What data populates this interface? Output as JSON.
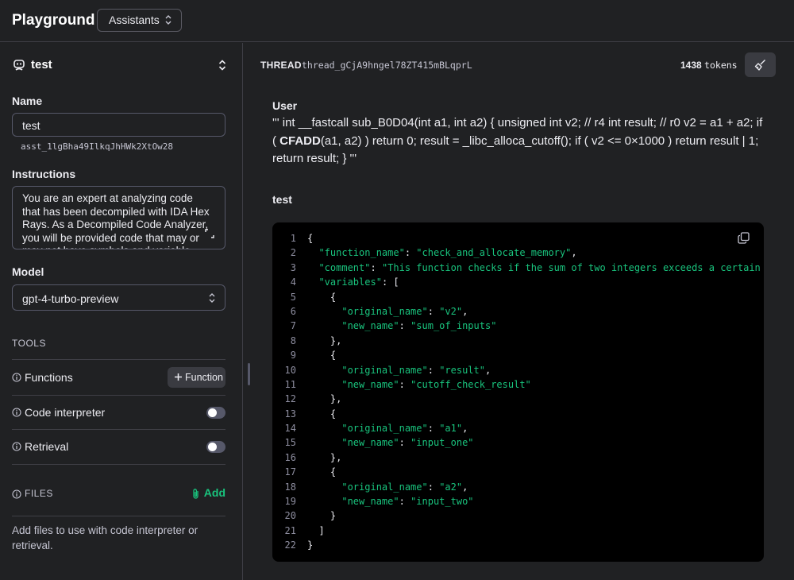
{
  "header": {
    "title": "Playground",
    "mode": "Assistants"
  },
  "assistant": {
    "name": "test",
    "name_label": "Name",
    "name_value": "test",
    "id": "asst_1lgBha49IlkqJhHWk2XtOw28",
    "instructions_label": "Instructions",
    "instructions": "You are an expert at analyzing code that has been decompiled with IDA Hex Rays. As a Decompiled Code Analyzer, you will be provided code that may or may not have symbols and variable names. You will",
    "model_label": "Model",
    "model": "gpt-4-turbo-preview"
  },
  "tools": {
    "label": "TOOLS",
    "functions": "Functions",
    "function_button": "Function",
    "code_interpreter": "Code interpreter",
    "code_interpreter_enabled": false,
    "retrieval": "Retrieval",
    "retrieval_enabled": false
  },
  "files": {
    "label": "FILES",
    "add": "Add",
    "description": "Add files to use with code interpreter or retrieval."
  },
  "thread": {
    "label": "THREAD",
    "id": "thread_gCjA9hngel78ZT415mBLqprL",
    "tokens_value": "1438",
    "tokens_label": "tokens"
  },
  "messages": {
    "user_role": "User",
    "user_text_1": "''' int __fastcall sub_B0D04(int a1, int a2) { unsigned int v2; // r4 int result; // r0 v2 = a1 + a2; if ( ",
    "user_text_bold": "CFADD",
    "user_text_2": "(a1, a2) ) return 0; result = _libc_alloca_cutoff(); if ( v2 <= 0×1000 ) return result | 1; return result; } '''",
    "assistant_role": "test"
  },
  "code": {
    "lines": [
      {
        "n": "1",
        "segs": [
          {
            "t": "{",
            "s": false
          }
        ]
      },
      {
        "n": "2",
        "segs": [
          {
            "t": "  ",
            "s": false
          },
          {
            "t": "\"function_name\"",
            "s": true
          },
          {
            "t": ": ",
            "s": false
          },
          {
            "t": "\"check_and_allocate_memory\"",
            "s": true
          },
          {
            "t": ",",
            "s": false
          }
        ]
      },
      {
        "n": "3",
        "segs": [
          {
            "t": "  ",
            "s": false
          },
          {
            "t": "\"comment\"",
            "s": true
          },
          {
            "t": ": ",
            "s": false
          },
          {
            "t": "\"This function checks if the sum of two integers exceeds a certain",
            "s": true
          }
        ]
      },
      {
        "n": "4",
        "segs": [
          {
            "t": "  ",
            "s": false
          },
          {
            "t": "\"variables\"",
            "s": true
          },
          {
            "t": ": [",
            "s": false
          }
        ]
      },
      {
        "n": "5",
        "segs": [
          {
            "t": "    {",
            "s": false
          }
        ]
      },
      {
        "n": "6",
        "segs": [
          {
            "t": "      ",
            "s": false
          },
          {
            "t": "\"original_name\"",
            "s": true
          },
          {
            "t": ": ",
            "s": false
          },
          {
            "t": "\"v2\"",
            "s": true
          },
          {
            "t": ",",
            "s": false
          }
        ]
      },
      {
        "n": "7",
        "segs": [
          {
            "t": "      ",
            "s": false
          },
          {
            "t": "\"new_name\"",
            "s": true
          },
          {
            "t": ": ",
            "s": false
          },
          {
            "t": "\"sum_of_inputs\"",
            "s": true
          }
        ]
      },
      {
        "n": "8",
        "segs": [
          {
            "t": "    },",
            "s": false
          }
        ]
      },
      {
        "n": "9",
        "segs": [
          {
            "t": "    {",
            "s": false
          }
        ]
      },
      {
        "n": "10",
        "segs": [
          {
            "t": "      ",
            "s": false
          },
          {
            "t": "\"original_name\"",
            "s": true
          },
          {
            "t": ": ",
            "s": false
          },
          {
            "t": "\"result\"",
            "s": true
          },
          {
            "t": ",",
            "s": false
          }
        ]
      },
      {
        "n": "11",
        "segs": [
          {
            "t": "      ",
            "s": false
          },
          {
            "t": "\"new_name\"",
            "s": true
          },
          {
            "t": ": ",
            "s": false
          },
          {
            "t": "\"cutoff_check_result\"",
            "s": true
          }
        ]
      },
      {
        "n": "12",
        "segs": [
          {
            "t": "    },",
            "s": false
          }
        ]
      },
      {
        "n": "13",
        "segs": [
          {
            "t": "    {",
            "s": false
          }
        ]
      },
      {
        "n": "14",
        "segs": [
          {
            "t": "      ",
            "s": false
          },
          {
            "t": "\"original_name\"",
            "s": true
          },
          {
            "t": ": ",
            "s": false
          },
          {
            "t": "\"a1\"",
            "s": true
          },
          {
            "t": ",",
            "s": false
          }
        ]
      },
      {
        "n": "15",
        "segs": [
          {
            "t": "      ",
            "s": false
          },
          {
            "t": "\"new_name\"",
            "s": true
          },
          {
            "t": ": ",
            "s": false
          },
          {
            "t": "\"input_one\"",
            "s": true
          }
        ]
      },
      {
        "n": "16",
        "segs": [
          {
            "t": "    },",
            "s": false
          }
        ]
      },
      {
        "n": "17",
        "segs": [
          {
            "t": "    {",
            "s": false
          }
        ]
      },
      {
        "n": "18",
        "segs": [
          {
            "t": "      ",
            "s": false
          },
          {
            "t": "\"original_name\"",
            "s": true
          },
          {
            "t": ": ",
            "s": false
          },
          {
            "t": "\"a2\"",
            "s": true
          },
          {
            "t": ",",
            "s": false
          }
        ]
      },
      {
        "n": "19",
        "segs": [
          {
            "t": "      ",
            "s": false
          },
          {
            "t": "\"new_name\"",
            "s": true
          },
          {
            "t": ": ",
            "s": false
          },
          {
            "t": "\"input_two\"",
            "s": true
          }
        ]
      },
      {
        "n": "20",
        "segs": [
          {
            "t": "    }",
            "s": false
          }
        ]
      },
      {
        "n": "21",
        "segs": [
          {
            "t": "  ]",
            "s": false
          }
        ]
      },
      {
        "n": "22",
        "segs": [
          {
            "t": "}",
            "s": false
          }
        ]
      }
    ]
  },
  "icons": {
    "robot": "robot-icon",
    "collapse": "chevron-up-down-icon",
    "expand": "expand-icon",
    "info": "info-icon",
    "plus": "plus-icon",
    "paperclip": "paperclip-icon",
    "clear": "broom-icon",
    "copy": "copy-icon"
  },
  "colors": {
    "background": "#202123",
    "code_background": "#000000",
    "string": "#19c37d",
    "accent": "#19c37d"
  }
}
